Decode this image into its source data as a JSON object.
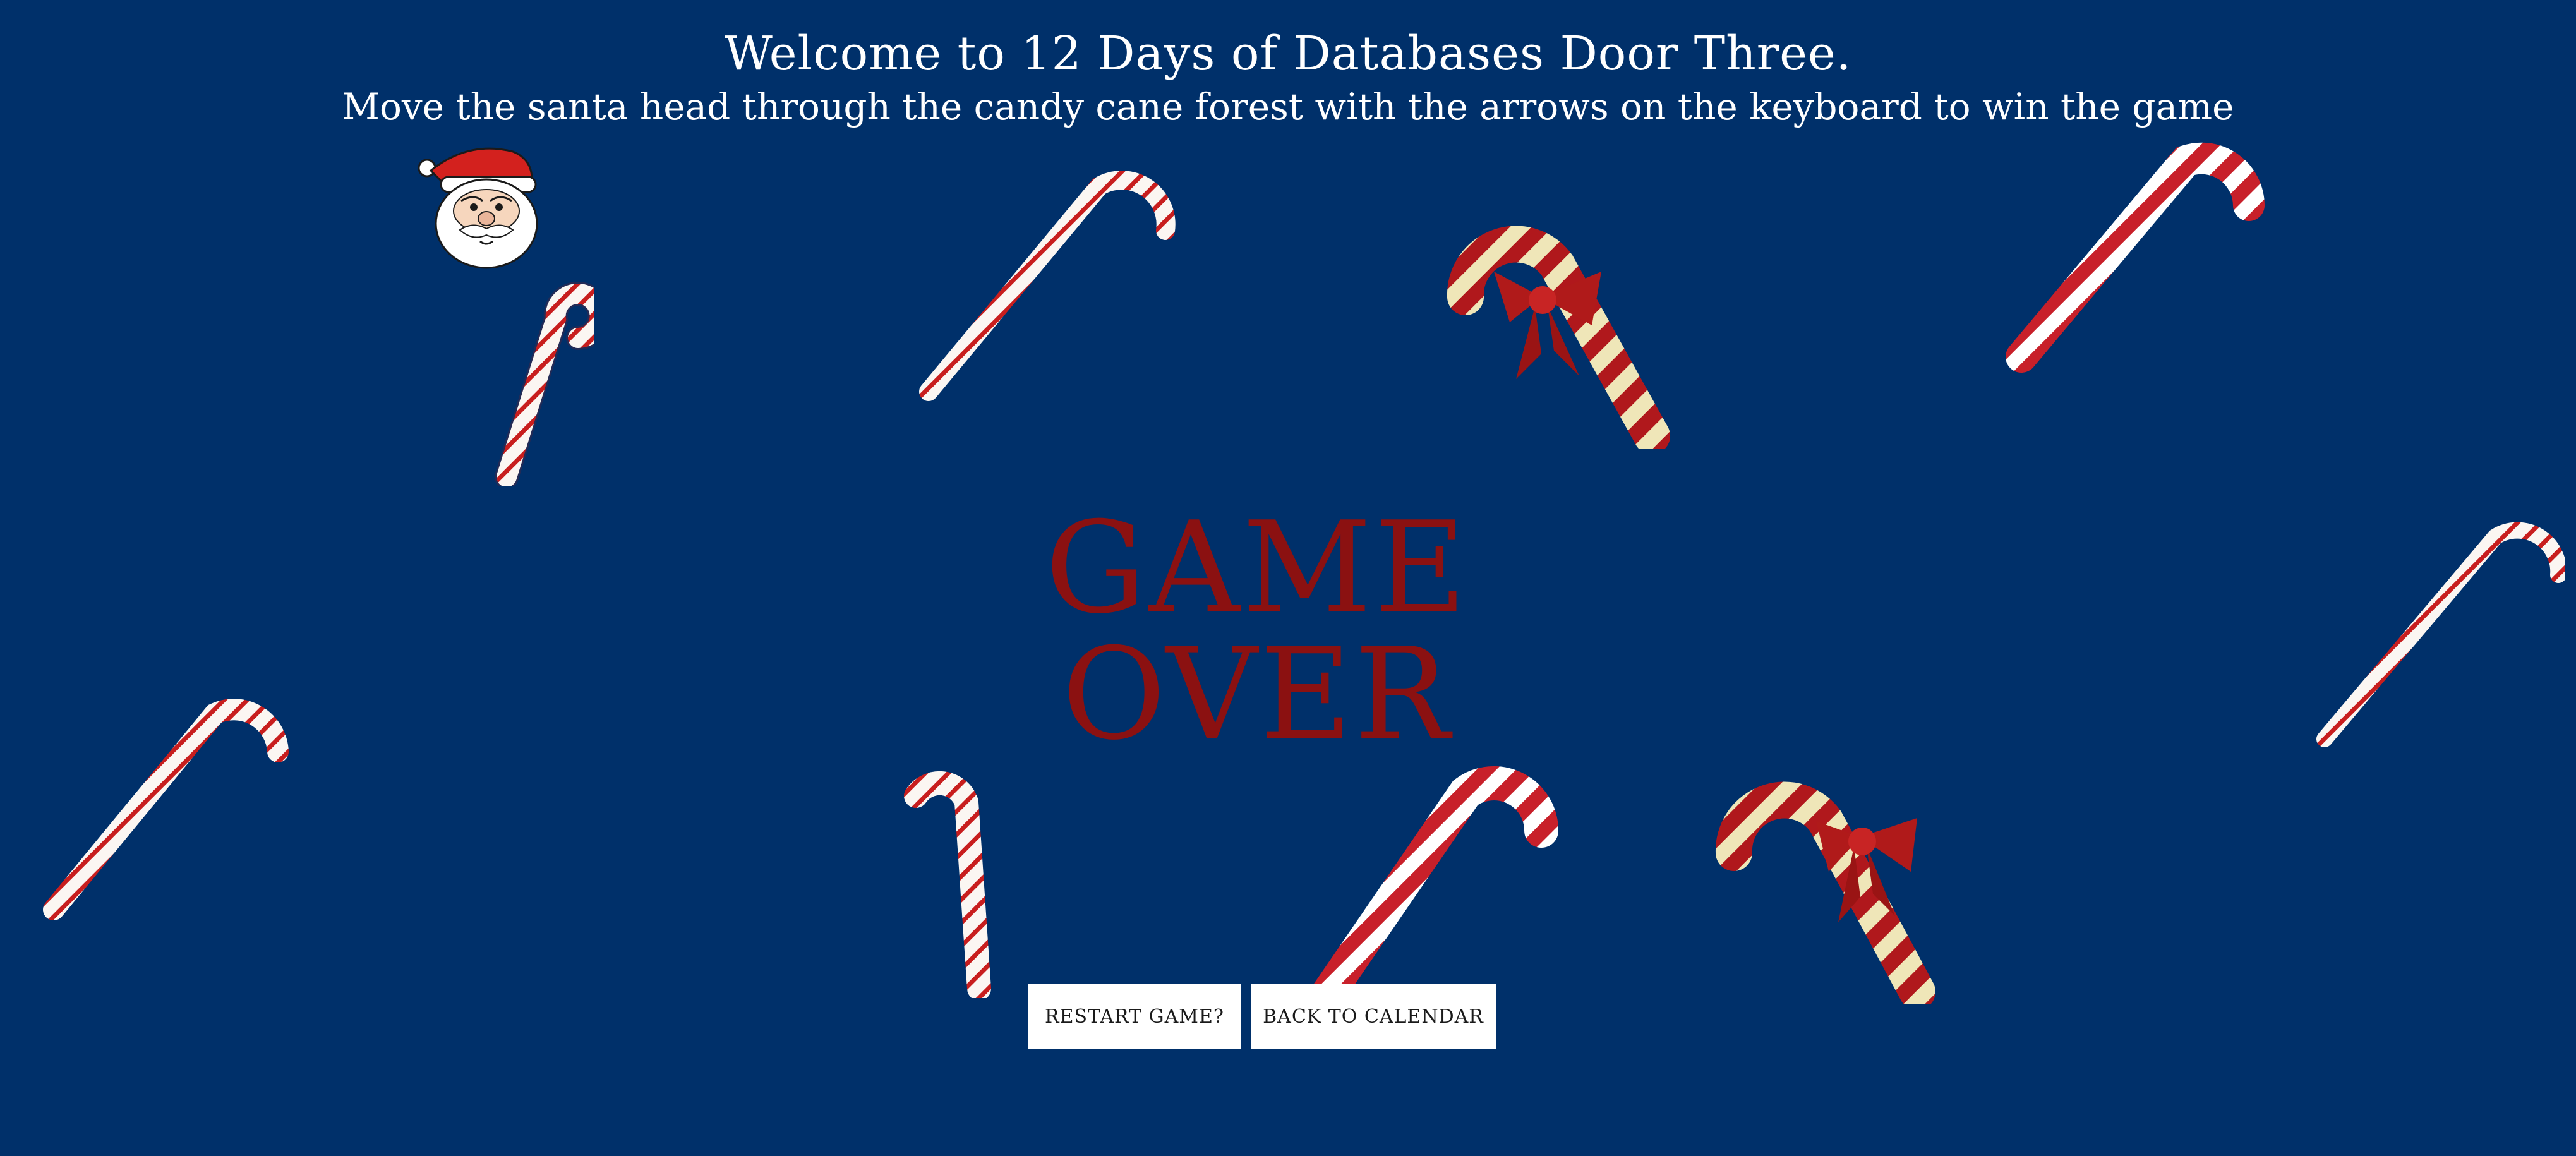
{
  "header": {
    "title": "Welcome to 12 Days of Databases Door Three.",
    "instructions": "Move the santa head through the candy cane forest with the arrows on the keyboard to win the game"
  },
  "game": {
    "status": "GAME OVER",
    "player_icon": "santa-head-icon",
    "obstacle_icon": "candy-cane-icon"
  },
  "buttons": {
    "restart_label": "RESTART GAME?",
    "calendar_label": "BACK TO CALENDAR"
  },
  "colors": {
    "background": "#00306a",
    "game_over": "#8b1111",
    "cane_red": "#c81e1e",
    "cane_white": "#ffffff",
    "bow_red": "#b01a1a"
  }
}
